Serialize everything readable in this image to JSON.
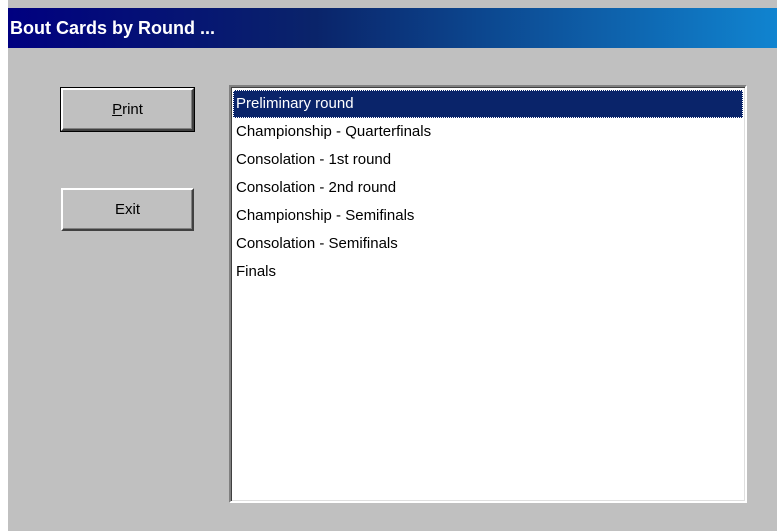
{
  "window": {
    "title": "Bout Cards by Round ..."
  },
  "buttons": {
    "print": {
      "label_prefix": "",
      "mnemonic": "P",
      "label_rest": "rint"
    },
    "exit": {
      "label": "Exit"
    }
  },
  "rounds_list": {
    "selected_index": 0,
    "items": [
      "Preliminary round",
      "Championship - Quarterfinals",
      "Consolation - 1st round",
      "Consolation - 2nd round",
      "Championship - Semifinals",
      "Consolation - Semifinals",
      "Finals"
    ]
  },
  "colors": {
    "title_gradient_start": "#000080",
    "title_gradient_end": "#1084d0",
    "face": "#c0c0c0",
    "selection": "#0a246a"
  }
}
